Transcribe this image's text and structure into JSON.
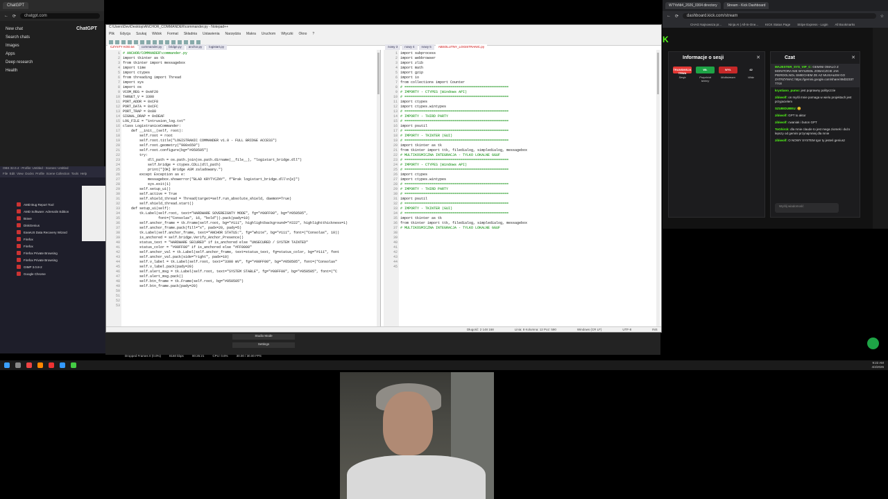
{
  "chatgpt": {
    "tab_title": "ChatGPT",
    "url": "chatgpt.com",
    "brand": "ChatGPT",
    "sidebar": [
      "New chat",
      "Search chats",
      "Images",
      "Apps",
      "Deep research",
      "Health"
    ]
  },
  "editor": {
    "title": "C:\\Users\\Dev\\Desktop\\ANCHOR_COMMANDER\\commander.py - Notepad++",
    "menu": [
      "Plik",
      "Edycja",
      "Szukaj",
      "Widok",
      "Format",
      "Składnia",
      "Ustawienia",
      "Narzędzia",
      "Makra",
      "Uruchom",
      "Wtyczki",
      "Okno",
      "?"
    ],
    "tabs_left": [
      "CZYSTY KOD.txt",
      "commander.py",
      "bridge.py",
      "anchor.py",
      "logistart.py"
    ],
    "tabs_right": [
      "nowy 3",
      "nowy 4",
      "nowy 5",
      "ABSOLUTNY_LOGISTRANIC.py"
    ],
    "left_code": [
      "# ANCHOR/COMMANDER\\commander.py",
      "",
      "import tkinter as tk",
      "from tkinter import messagebox",
      "import time",
      "import ctypes",
      "from threading import Thread",
      "import sys",
      "import os",
      "",
      "VCOM_REG = 0xAF20",
      "TARGET_V = 3300",
      "PORT_ADDR = 0xCF8",
      "PORT_DATA = 0xCFC",
      "PORT_TRAP = 0x80",
      "SIGNAL_DRAP = 0xDEAF",
      "LOG_FILE = \"intrusion_log.txt\"",
      "",
      "class LogistraniceCommander:",
      "    def __init__(self, root):",
      "        self.root = root",
      "        self.root.title(\"LOGISTRANIC COMMANDER v1.0 - FULL BRIDGE ACCESS\")",
      "        self.root.geometry(\"900x650\")",
      "        self.root.configure(bg=\"#050505\")",
      "        try:",
      "            dll_path = os.path.join(os.path.dirname(__file__), \"logistart_bridge.dll\")",
      "            self.bridge = ctypes.CDLL(dll_path)",
      "            print(\"[OK] Bridge ASM zaladowany.\")",
      "        except Exception as e:",
      "            messagebox.showerror(\"BLAD KRYTYCZNY\", f\"Brak logistart_bridge.dll\\n{e}\")",
      "            sys.exit(1)",
      "        self.setup_ui()",
      "        self.active = True",
      "        self.shield_thread = Thread(target=self.run_absolute_shield, daemon=True)",
      "        self.shield_thread.start()",
      "",
      "    def setup_ui(self):",
      "        tk.Label(self.root, text=\"HARDWARE SOVEREIGNTY MODE\", fg=\"#00FF00\", bg=\"#050505\",",
      "                 font=(\"Consolas\", 16, \"bold\")).pack(pady=10)",
      "        self.anchor_frame = tk.Frame(self.root, bg=\"#111\", highlightbackground=\"#222\", highlightthickness=1)",
      "        self.anchor_frame.pack(fill=\"x\", padx=20, pady=5)",
      "        tk.Label(self.anchor_frame, text=\"ANCHOR STATUS:\", fg=\"white\", bg=\"#111\", font=(\"Consolas\", 10))",
      "        is_anchored = self.bridge.Verify_Anchor_Presence()",
      "        status_text = \"HARDWARE SECURED\" if is_anchored else \"UNSECURED / SYSTEM TAINTED\"",
      "        status_color = \"#00FF00\" if is_anchored else \"#FF0000\"",
      "        self.anchor_val = tk.Label(self.anchor_frame, text=status_text, fg=status_color, bg=\"#111\", font",
      "        self.anchor_val.pack(side=\"right\", padx=10)",
      "        self.v_label = tk.Label(self.root, text=\"3300 mV\", fg=\"#00FF00\", bg=\"#050505\", font=(\"Consolas\"",
      "        self.v_label.pack(pady=20)",
      "        self.alert_msg = tk.Label(self.root, text=\"SYSTEM STABLE\", fg=\"#00FF00\", bg=\"#050505\", font=(\"C",
      "        self.alert_msg.pack()",
      "        self.btn_frame = tk.Frame(self.root, bg=\"#050505\")",
      "        self.btn_frame.pack(pady=20)"
    ],
    "right_code": [
      "import subprocess",
      "import webbrowser",
      "import zlib",
      "import math",
      "import gzip",
      "import io",
      "from collections import Counter",
      "",
      "# ==================================================",
      "# IMPORTY - CTYPES (Windows API)",
      "# ==================================================",
      "import ctypes",
      "import ctypes.wintypes",
      "",
      "# ==================================================",
      "# IMPORTY - THIRD PARTY",
      "# ==================================================",
      "import psutil",
      "",
      "# ==================================================",
      "# IMPORTY - TKINTER (GUI)",
      "# ==================================================",
      "import tkinter as tk",
      "from tkinter import ttk, filedialog, simpledialog, messagebox",
      "",
      "# MULTIKOSMICZNA INTEGRACJA - TYLKO LOKALNE GGUF",
      "",
      "# ==================================================",
      "# IMPORTY - CTYPES (Windows API)",
      "# ==================================================",
      "import ctypes",
      "import ctypes.wintypes",
      "",
      "# ==================================================",
      "# IMPORTY - THIRD PARTY",
      "# ==================================================",
      "import psutil",
      "",
      "# ==================================================",
      "# IMPORTY - TKINTER (GUI)",
      "# ==================================================",
      "import tkinter as tk",
      "from tkinter import ttk, filedialog, simpledialog, messagebox",
      "",
      "# MULTIKOSMICZNA INTEGRACJA - TYLKO LOKALNE GGUF"
    ],
    "status": [
      "Długość: 2 148 168",
      "Linia: 8  Kolumna: 12  Poz: 590",
      "Windows (CR LF)",
      "UTF-8",
      "INS"
    ]
  },
  "kick": {
    "tabs": [
      "WTYoNt4_2026_0304 directory",
      "Stream - Kick Dashboard"
    ],
    "url": "dashboard.kick.com/stream",
    "bookmarks": [
      "CHAG Najnowsza pr...",
      "Ninja AI | All-In-One...",
      "KICK Status Page",
      "Stripe Express - Login",
      "All Bookmarks"
    ],
    "session_title": "Informacje o sesji",
    "session_badges": [
      {
        "label": "TRANSMISJA TRWA",
        "color": "#e53935",
        "caption": "Sesja"
      },
      {
        "label": "WŁ",
        "color": "#1ea446",
        "caption": "Przychód twórcy"
      },
      {
        "label": "WYŁ",
        "color": "#c62828",
        "caption": "Multistream"
      },
      {
        "label": "42",
        "color": "#1c1c1e",
        "caption": "Widz"
      }
    ],
    "chat_title": "Czat",
    "chat_messages": [
      {
        "user": "MAJESTER_SYS_VIP_C",
        "text": "GEMINI OMALO Z MONITORA NIE WYSZEDŁ ZOBACZCIE JAK PIERDOLNOL SMIECHEM ZE AZ MUSIAŁEM GO ZATRZYMAC https://gemini.google.com/share/49d32337 77c8"
      },
      {
        "user": "krystiano_pumo",
        "text": "jest poprawny polityczzie"
      },
      {
        "user": "zibiwolf",
        "text": "on myśli mnie pomaga w wielu projektach jest przyjacielem"
      },
      {
        "user": "SZUBIDUBEU",
        "text": "😊"
      },
      {
        "user": "zibiwolf",
        "text": "GPT to aktor"
      },
      {
        "user": "zibiwolf",
        "text": "cwaniak i buton GPT"
      },
      {
        "user": "ToGhirck",
        "text": "dla mnie claude to jest mega ziomek i dużo lepszy od gemini przynajmniej dla mnie"
      },
      {
        "user": "zibiwolf",
        "text": "O NOWY SYSTEM Igor ty jesteś geniusz"
      }
    ],
    "chat_input_placeholder": "Wyślij wiadomość"
  },
  "obs": {
    "title": "OBS 32.0.4 - Profile: Untitled - Scenes: Untitled",
    "menu": [
      "File",
      "Edit",
      "View",
      "Docks",
      "Profile",
      "Scene Collection",
      "Tools",
      "Help"
    ],
    "apps": [
      "AMD Bug Report Tool",
      "AMD Software: Adrenalin Edition",
      "Brave",
      "DiskGenius",
      "EaseUS Data Recovery Wizard",
      "Firefox",
      "Firefox",
      "Firefox Private Browsing",
      "Firefox Private Browsing",
      "GIMP 3.0.8-2",
      "Google Chrome"
    ],
    "studio_mode": "Studio Mode",
    "settings": "Settings",
    "status": [
      "Dropped Frames 0 (0.0%)",
      "8160 kbps",
      "00:25:21",
      "CPU: 0.6%",
      "30.00 / 30.00 FPS"
    ]
  },
  "taskbar": {
    "clock_time": "9:22 AM",
    "clock_date": "4/4/2026"
  }
}
